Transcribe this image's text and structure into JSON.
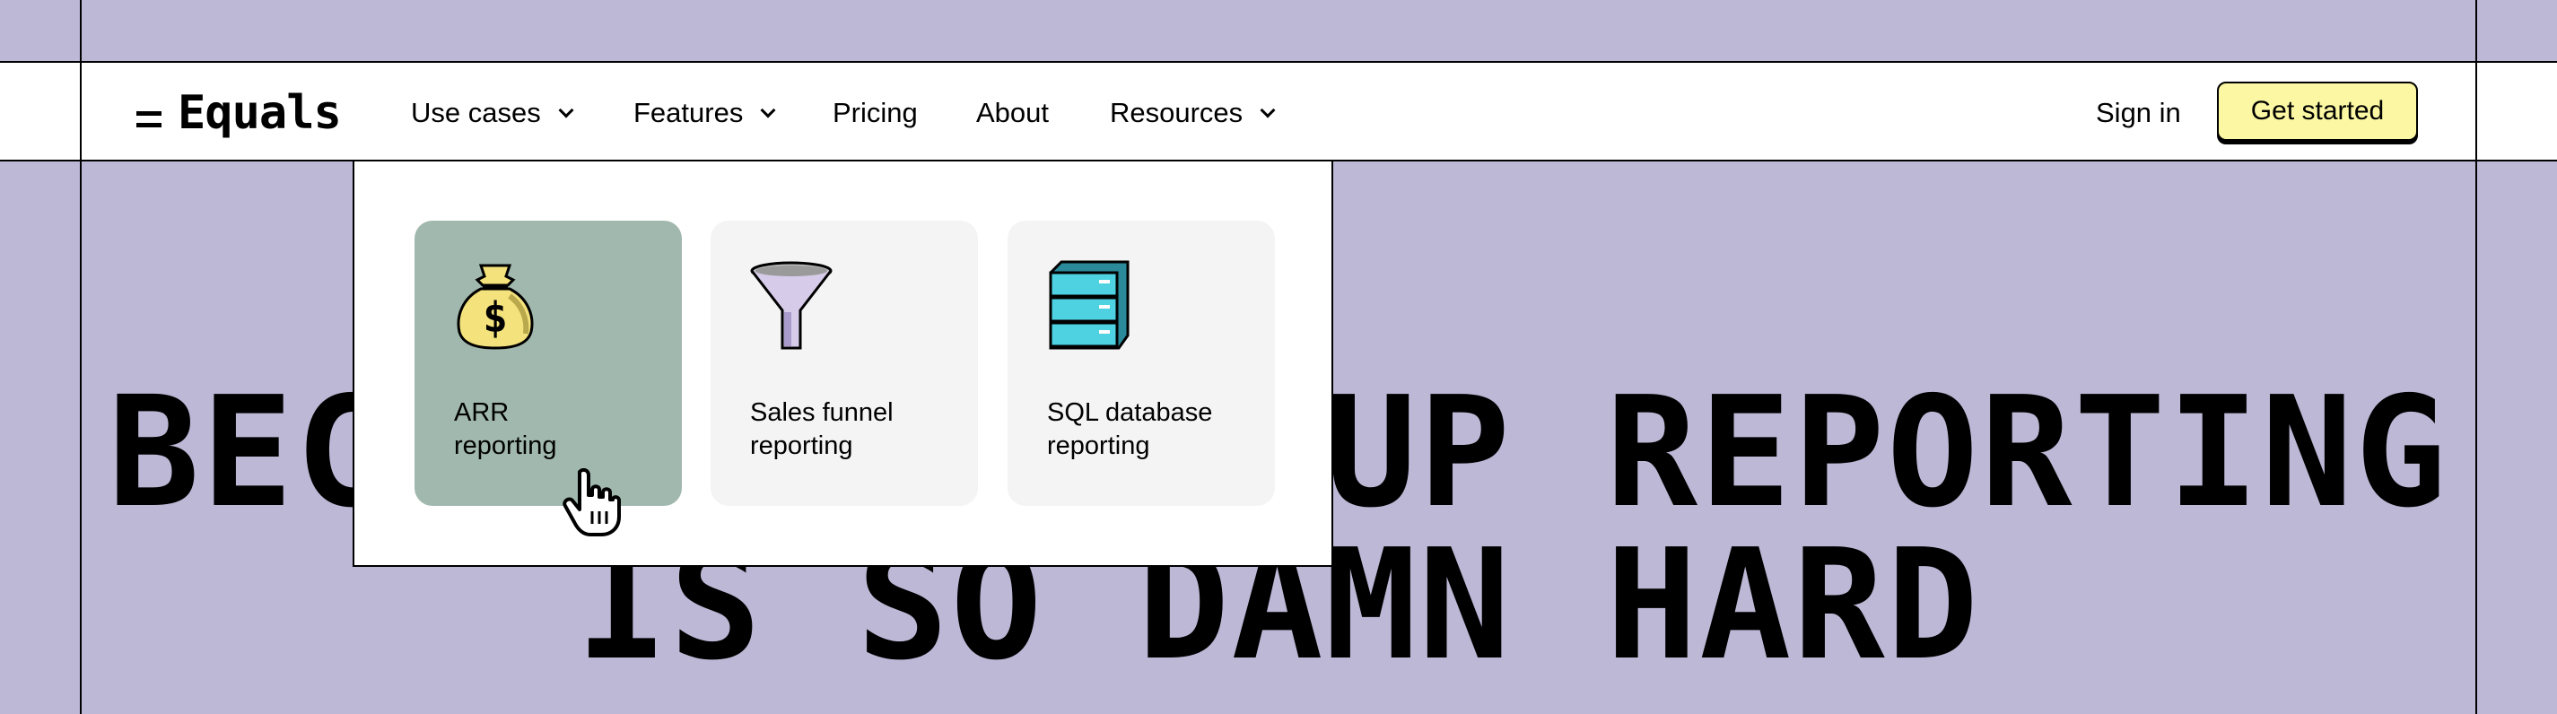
{
  "nav": {
    "logo_text": "Equals",
    "items": [
      {
        "label": "Use cases",
        "has_dropdown": true
      },
      {
        "label": "Features",
        "has_dropdown": true
      },
      {
        "label": "Pricing",
        "has_dropdown": false
      },
      {
        "label": "About",
        "has_dropdown": false
      },
      {
        "label": "Resources",
        "has_dropdown": true
      }
    ],
    "sign_in": "Sign in",
    "get_started": "Get started"
  },
  "hero": {
    "line1": "BECAUSE STARTUP REPORTING",
    "line2": "IS SO DAMN HARD"
  },
  "dropdown": {
    "open_menu": "Use cases",
    "cards": [
      {
        "line1": "ARR",
        "line2": "reporting",
        "icon": "money-bag-icon",
        "active": true
      },
      {
        "line1": "Sales funnel",
        "line2": "reporting",
        "icon": "funnel-icon",
        "active": false
      },
      {
        "line1": "SQL database",
        "line2": "reporting",
        "icon": "database-icon",
        "active": false
      }
    ]
  },
  "colors": {
    "background": "#bcb8d6",
    "cta": "#fbf7a2",
    "active_card": "#a1b8ae",
    "card": "#f4f4f4"
  }
}
